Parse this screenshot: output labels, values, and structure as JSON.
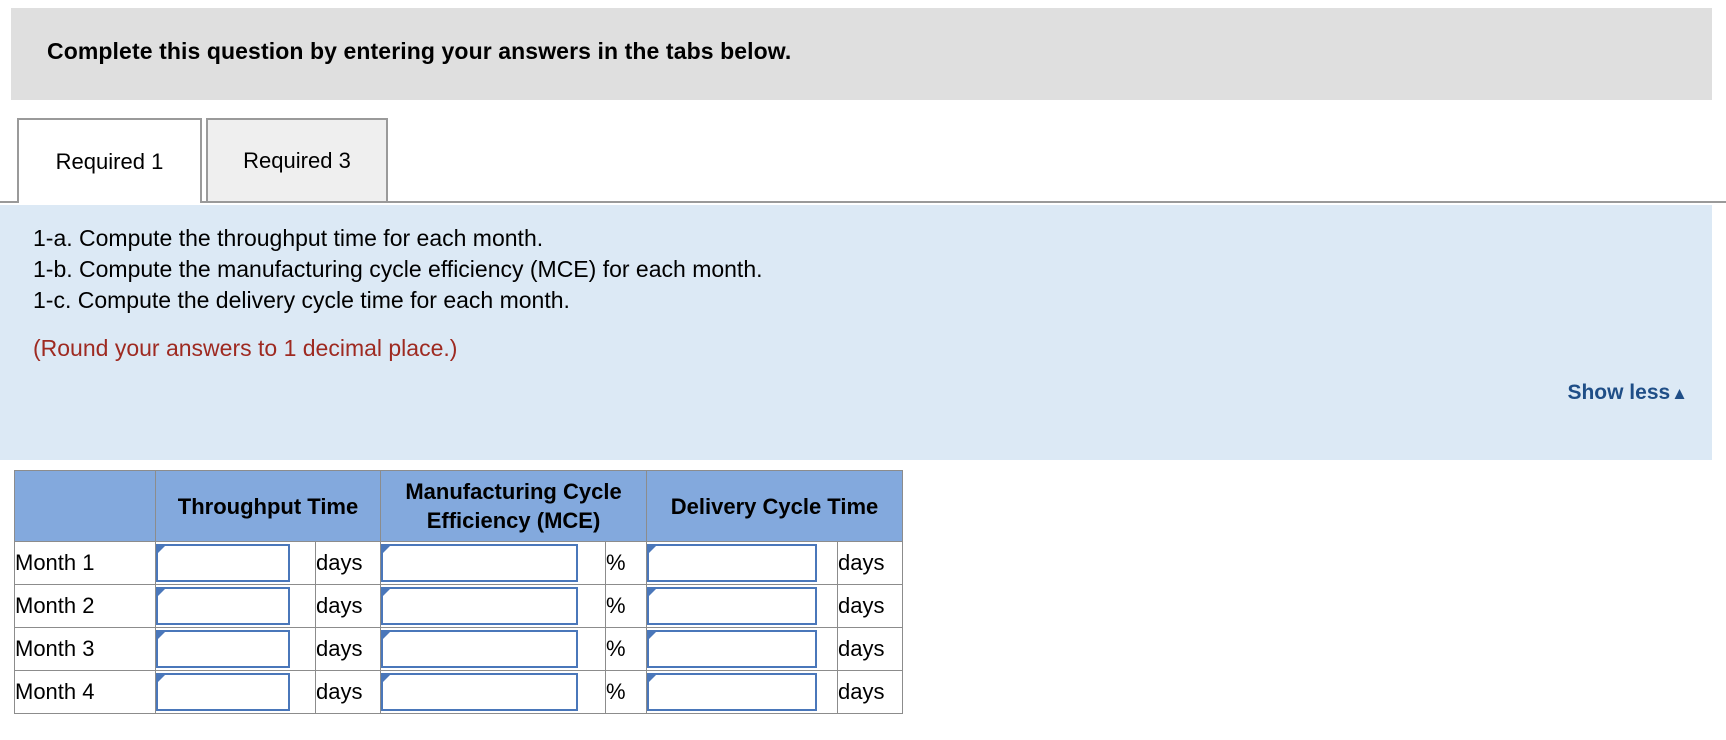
{
  "banner": {
    "text": "Complete this question by entering your answers in the tabs below."
  },
  "tabs": [
    {
      "label": "Required 1",
      "active": true
    },
    {
      "label": "Required 3",
      "active": false
    }
  ],
  "panel": {
    "instructions": [
      "1-a. Compute the throughput time for each month.",
      "1-b. Compute the manufacturing cycle efficiency (MCE) for each month.",
      "1-c. Compute the delivery cycle time for each month."
    ],
    "note": "(Round your answers to 1 decimal place.)",
    "show_less_label": "Show less",
    "show_less_caret": "▲"
  },
  "table": {
    "headers": {
      "blank": "",
      "throughput_time": "Throughput Time",
      "mce_line1": "Manufacturing Cycle",
      "mce_line2": "Efficiency (MCE)",
      "delivery_cycle_time": "Delivery Cycle Time"
    },
    "units": {
      "days": "days",
      "percent": "%"
    },
    "rows": [
      {
        "label": "Month 1",
        "throughput_time": "",
        "mce": "",
        "delivery_cycle_time": ""
      },
      {
        "label": "Month 2",
        "throughput_time": "",
        "mce": "",
        "delivery_cycle_time": ""
      },
      {
        "label": "Month 3",
        "throughput_time": "",
        "mce": "",
        "delivery_cycle_time": ""
      },
      {
        "label": "Month 4",
        "throughput_time": "",
        "mce": "",
        "delivery_cycle_time": ""
      }
    ]
  },
  "colors": {
    "banner_bg": "#dfdfdf",
    "panel_bg": "#dce9f5",
    "header_blue": "#83a9dd",
    "input_border_blue": "#4a77ba",
    "link_blue": "#1f4e87",
    "note_red": "#9e2a21"
  }
}
